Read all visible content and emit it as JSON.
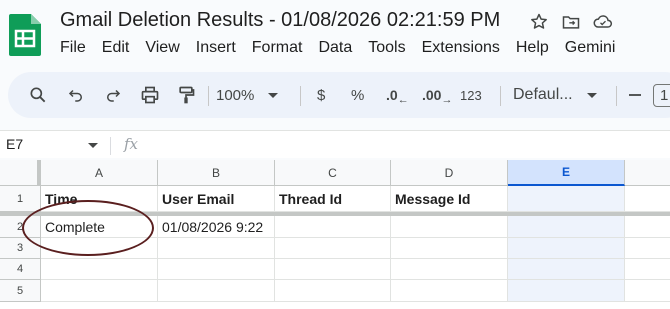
{
  "app": {
    "title": "Gmail Deletion Results - 01/08/2026 02:21:59 PM",
    "menu": [
      "File",
      "Edit",
      "View",
      "Insert",
      "Format",
      "Data",
      "Tools",
      "Extensions",
      "Help",
      "Gemini"
    ]
  },
  "toolbar": {
    "zoom": "100%",
    "currency": "$",
    "percent": "%",
    "decrease_decimal": ".0",
    "increase_decimal": ".00",
    "number_format": "123",
    "font": "Defaul...",
    "font_size": "1"
  },
  "formula_bar": {
    "name_box": "E7",
    "fx": "fx"
  },
  "sheet": {
    "columns": [
      "A",
      "B",
      "C",
      "D",
      "E"
    ],
    "selected_column": "E",
    "rows": [
      "1",
      "2",
      "3",
      "4",
      "5"
    ],
    "header_row": {
      "A": "Time",
      "B": "User Email",
      "C": "Thread Id",
      "D": "Message Id"
    },
    "row2": {
      "A": "Complete",
      "B": "01/08/2026 9:22"
    }
  },
  "colors": {
    "accent": "#0b57d0",
    "sheets_green": "#0f9d58",
    "annotation": "#5a1f1f"
  }
}
